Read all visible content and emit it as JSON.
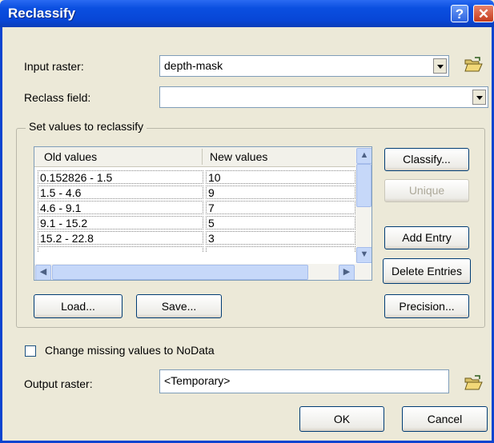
{
  "window": {
    "title": "Reclassify",
    "help_glyph": "?",
    "close_glyph": "✕"
  },
  "input_raster": {
    "label": "Input raster:",
    "value": "depth-mask"
  },
  "reclass_field": {
    "label": "Reclass field:",
    "value": ""
  },
  "group": {
    "legend": "Set values to reclassify"
  },
  "table": {
    "headers": [
      "Old values",
      "New values"
    ],
    "rows": [
      {
        "old": "0.152826 - 1.5",
        "new": "10"
      },
      {
        "old": "1.5 - 4.6",
        "new": "9"
      },
      {
        "old": "4.6 - 9.1",
        "new": "7"
      },
      {
        "old": "9.1 - 15.2",
        "new": "5"
      },
      {
        "old": "15.2 - 22.8",
        "new": "3"
      }
    ]
  },
  "buttons": {
    "classify": "Classify...",
    "unique": "Unique",
    "add_entry": "Add Entry",
    "delete_entries": "Delete Entries",
    "load": "Load...",
    "save": "Save...",
    "precision": "Precision...",
    "ok": "OK",
    "cancel": "Cancel"
  },
  "missing": {
    "label": "Change missing values to NoData",
    "checked": false
  },
  "output_raster": {
    "label": "Output raster:",
    "value": "<Temporary>"
  },
  "icons": [
    "help-icon",
    "close-icon",
    "folder-open-icon",
    "chevron-down-icon",
    "scroll-up-icon",
    "scroll-down-icon",
    "scroll-left-icon",
    "scroll-right-icon"
  ],
  "colors": {
    "titlebar": "#0846D6",
    "dialog_bg": "#ECE9D8",
    "close_button": "#C43C1C"
  }
}
